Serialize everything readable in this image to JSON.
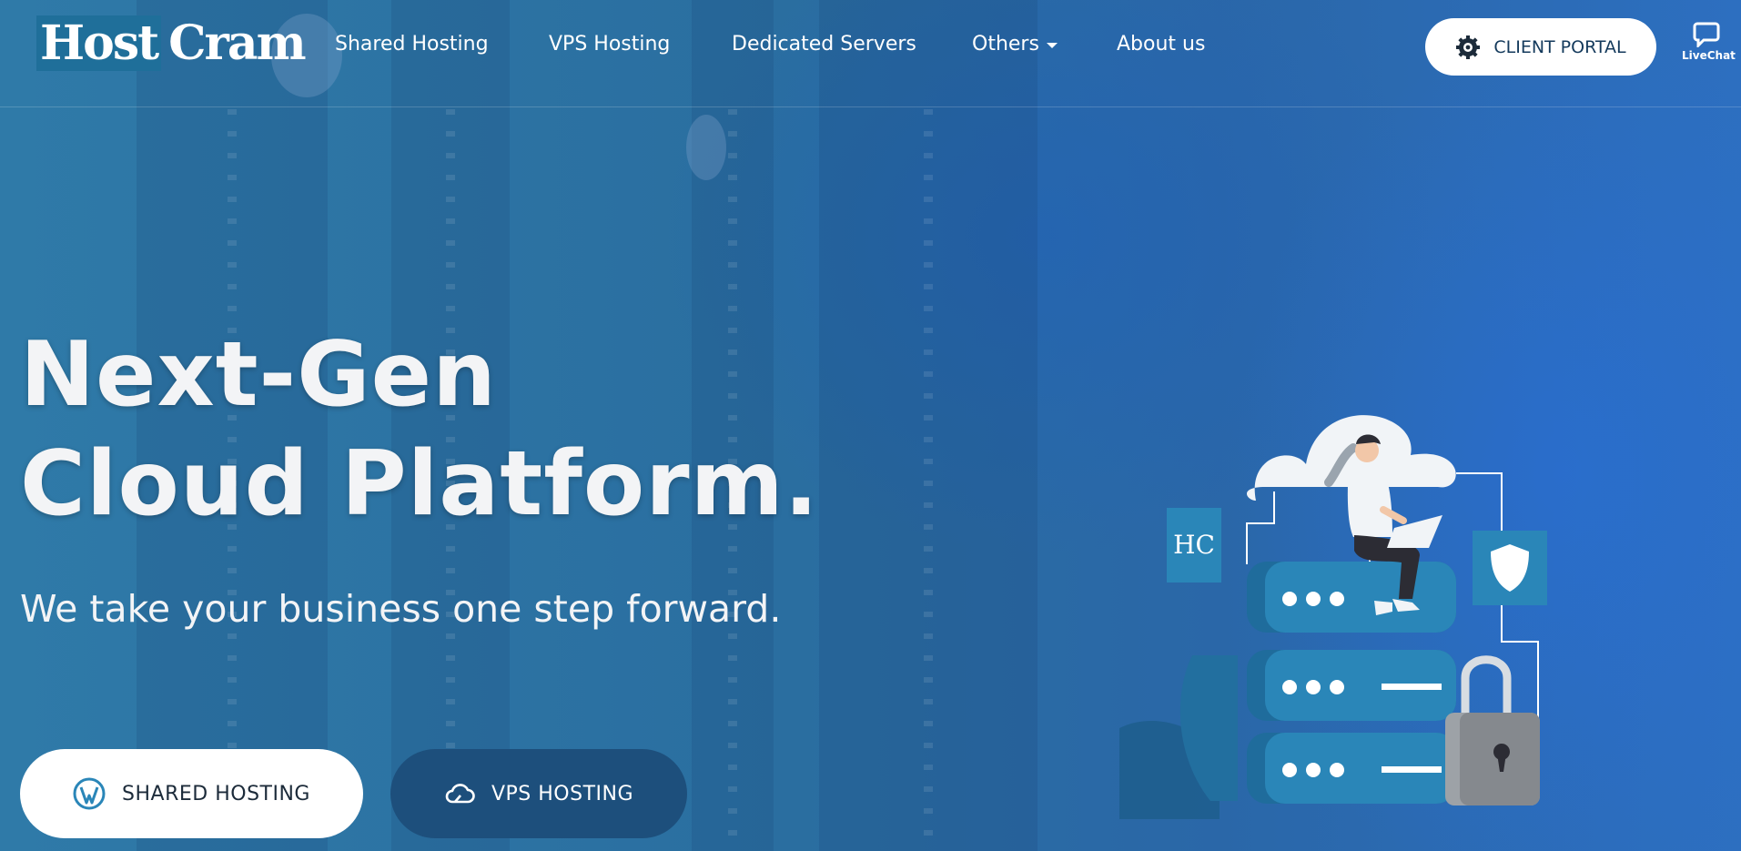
{
  "brand": {
    "logo_part1": "Host",
    "logo_part2": "Cram"
  },
  "nav": {
    "items": [
      "Shared Hosting",
      "VPS Hosting",
      "Dedicated Servers",
      "Others",
      "About us"
    ],
    "client_portal": "CLIENT PORTAL",
    "livechat": "LiveChat"
  },
  "hero": {
    "title_line1": "Next-Gen",
    "title_line2": "Cloud Platform.",
    "subtitle": "We take your business one step forward.",
    "cta_shared": "SHARED HOSTING",
    "cta_vps": "VPS HOSTING"
  },
  "illustration": {
    "tag": "HC"
  },
  "icons": [
    "gear-icon",
    "chat-bubble-icon",
    "caret-down-icon",
    "wordpress-icon",
    "cloud-icon",
    "shield-icon",
    "padlock-icon"
  ],
  "colors": {
    "background": "#2a6fa6",
    "button_dark": "#1d4f7c",
    "server_blue": "#2a86b8",
    "text": "#f3f4f6"
  }
}
